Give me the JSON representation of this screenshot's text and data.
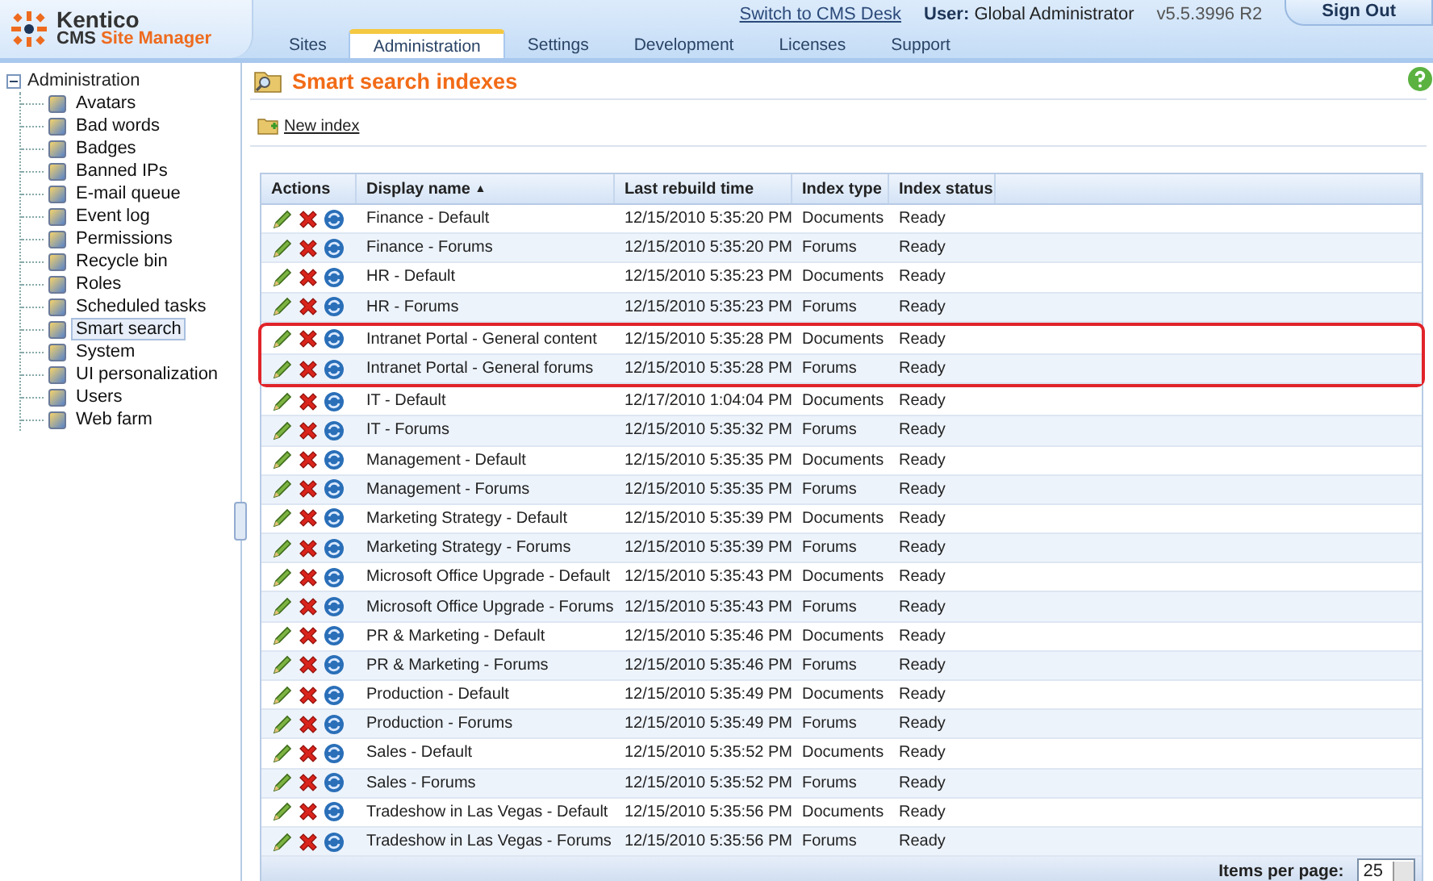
{
  "header": {
    "logo": {
      "brand": "Kentico",
      "product_prefix": "CMS",
      "product": "Site Manager"
    },
    "switch_link": "Switch to CMS Desk",
    "user_label": "User:",
    "user_name": "Global Administrator",
    "version": "v5.5.3996 R2",
    "sign_out": "Sign Out",
    "tabs": [
      {
        "label": "Sites",
        "selected": false
      },
      {
        "label": "Administration",
        "selected": true
      },
      {
        "label": "Settings",
        "selected": false
      },
      {
        "label": "Development",
        "selected": false
      },
      {
        "label": "Licenses",
        "selected": false
      },
      {
        "label": "Support",
        "selected": false
      }
    ]
  },
  "sidebar": {
    "root": {
      "label": "Administration",
      "expanded": true,
      "children": [
        {
          "label": "Avatars",
          "selected": false
        },
        {
          "label": "Bad words",
          "selected": false
        },
        {
          "label": "Badges",
          "selected": false
        },
        {
          "label": "Banned IPs",
          "selected": false
        },
        {
          "label": "E-mail queue",
          "selected": false
        },
        {
          "label": "Event log",
          "selected": false
        },
        {
          "label": "Permissions",
          "selected": false
        },
        {
          "label": "Recycle bin",
          "selected": false
        },
        {
          "label": "Roles",
          "selected": false
        },
        {
          "label": "Scheduled tasks",
          "selected": false
        },
        {
          "label": "Smart search",
          "selected": true
        },
        {
          "label": "System",
          "selected": false
        },
        {
          "label": "UI personalization",
          "selected": false
        },
        {
          "label": "Users",
          "selected": false
        },
        {
          "label": "Web farm",
          "selected": false
        }
      ]
    }
  },
  "content": {
    "title": "Smart search indexes",
    "new_index": "New index",
    "table": {
      "columns": [
        "Actions",
        "Display name",
        "Last rebuild time",
        "Index type",
        "Index status"
      ],
      "sort_mark": "▲",
      "rows": [
        {
          "name": "Finance - Default",
          "time": "12/15/2010 5:35:20 PM",
          "type": "Documents",
          "status": "Ready",
          "highlighted": false
        },
        {
          "name": "Finance - Forums",
          "time": "12/15/2010 5:35:20 PM",
          "type": "Forums",
          "status": "Ready",
          "highlighted": false
        },
        {
          "name": "HR - Default",
          "time": "12/15/2010 5:35:23 PM",
          "type": "Documents",
          "status": "Ready",
          "highlighted": false
        },
        {
          "name": "HR - Forums",
          "time": "12/15/2010 5:35:23 PM",
          "type": "Forums",
          "status": "Ready",
          "highlighted": false
        },
        {
          "name": "Intranet Portal - General content",
          "time": "12/15/2010 5:35:28 PM",
          "type": "Documents",
          "status": "Ready",
          "highlighted": true
        },
        {
          "name": "Intranet Portal - General forums",
          "time": "12/15/2010 5:35:28 PM",
          "type": "Forums",
          "status": "Ready",
          "highlighted": true
        },
        {
          "name": "IT - Default",
          "time": "12/17/2010 1:04:04 PM",
          "type": "Documents",
          "status": "Ready",
          "highlighted": false
        },
        {
          "name": "IT - Forums",
          "time": "12/15/2010 5:35:32 PM",
          "type": "Forums",
          "status": "Ready",
          "highlighted": false
        },
        {
          "name": "Management - Default",
          "time": "12/15/2010 5:35:35 PM",
          "type": "Documents",
          "status": "Ready",
          "highlighted": false
        },
        {
          "name": "Management - Forums",
          "time": "12/15/2010 5:35:35 PM",
          "type": "Forums",
          "status": "Ready",
          "highlighted": false
        },
        {
          "name": "Marketing Strategy - Default",
          "time": "12/15/2010 5:35:39 PM",
          "type": "Documents",
          "status": "Ready",
          "highlighted": false
        },
        {
          "name": "Marketing Strategy - Forums",
          "time": "12/15/2010 5:35:39 PM",
          "type": "Forums",
          "status": "Ready",
          "highlighted": false
        },
        {
          "name": "Microsoft Office Upgrade - Default",
          "time": "12/15/2010 5:35:43 PM",
          "type": "Documents",
          "status": "Ready",
          "highlighted": false
        },
        {
          "name": "Microsoft Office Upgrade - Forums",
          "time": "12/15/2010 5:35:43 PM",
          "type": "Forums",
          "status": "Ready",
          "highlighted": false
        },
        {
          "name": "PR & Marketing - Default",
          "time": "12/15/2010 5:35:46 PM",
          "type": "Documents",
          "status": "Ready",
          "highlighted": false
        },
        {
          "name": "PR & Marketing - Forums",
          "time": "12/15/2010 5:35:46 PM",
          "type": "Forums",
          "status": "Ready",
          "highlighted": false
        },
        {
          "name": "Production - Default",
          "time": "12/15/2010 5:35:49 PM",
          "type": "Documents",
          "status": "Ready",
          "highlighted": false
        },
        {
          "name": "Production - Forums",
          "time": "12/15/2010 5:35:49 PM",
          "type": "Forums",
          "status": "Ready",
          "highlighted": false
        },
        {
          "name": "Sales - Default",
          "time": "12/15/2010 5:35:52 PM",
          "type": "Documents",
          "status": "Ready",
          "highlighted": false
        },
        {
          "name": "Sales - Forums",
          "time": "12/15/2010 5:35:52 PM",
          "type": "Forums",
          "status": "Ready",
          "highlighted": false
        },
        {
          "name": "Tradeshow in Las Vegas - Default",
          "time": "12/15/2010 5:35:56 PM",
          "type": "Documents",
          "status": "Ready",
          "highlighted": false
        },
        {
          "name": "Tradeshow in Las Vegas - Forums",
          "time": "12/15/2010 5:35:56 PM",
          "type": "Forums",
          "status": "Ready",
          "highlighted": false
        }
      ]
    },
    "pager": {
      "label": "Items per page:",
      "value": "25"
    }
  }
}
